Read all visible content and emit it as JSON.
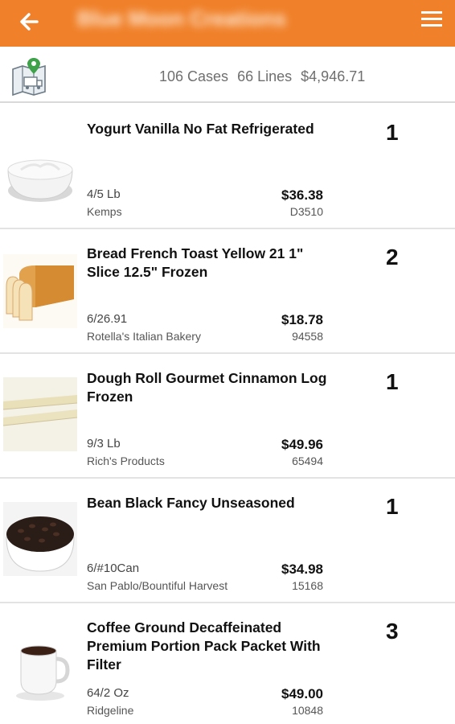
{
  "header": {
    "title": "Blue Moon Creations",
    "back_icon": "back-arrow-icon",
    "menu_icon": "hamburger-menu-icon",
    "color": "#f0812a"
  },
  "summary": {
    "cases": "106 Cases",
    "lines": "66 Lines",
    "total": "$4,946.71",
    "icon": "map-route-icon"
  },
  "items": [
    {
      "name": "Yogurt Vanilla No Fat Refrigerated",
      "pack": "4/5 Lb",
      "brand": "Kemps",
      "price": "$36.38",
      "code": "D3510",
      "qty": "1",
      "image": "yogurt-bowl"
    },
    {
      "name": "Bread French Toast Yellow 21 1\" Slice 12.5\" Frozen",
      "pack": "6/26.91",
      "brand": "Rotella's Italian Bakery",
      "price": "$18.78",
      "code": "94558",
      "qty": "2",
      "image": "sliced-bread"
    },
    {
      "name": "Dough Roll Gourmet Cinnamon Log Frozen",
      "pack": "9/3 Lb",
      "brand": "Rich's Products",
      "price": "$49.96",
      "code": "65494",
      "qty": "1",
      "image": "dough-logs"
    },
    {
      "name": "Bean Black Fancy Unseasoned",
      "pack": "6/#10Can",
      "brand": "San Pablo/Bountiful Harvest",
      "price": "$34.98",
      "code": "15168",
      "qty": "1",
      "image": "black-beans-bowl"
    },
    {
      "name": "Coffee Ground Decaffeinated Premium Portion Pack Packet With Filter",
      "pack": "64/2 Oz",
      "brand": "Ridgeline",
      "price": "$49.00",
      "code": "10848",
      "qty": "3",
      "image": "coffee-cup"
    }
  ]
}
